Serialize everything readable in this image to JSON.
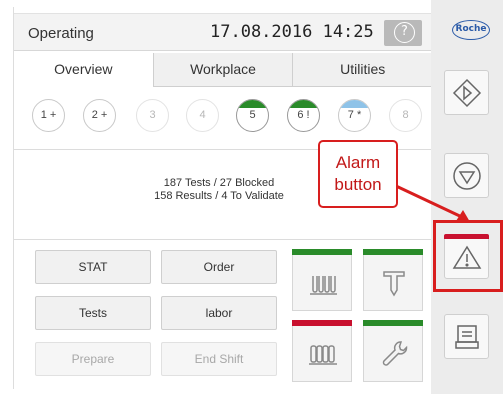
{
  "status": {
    "text": "Operating",
    "datetime": "17.08.2016 14:25",
    "help_icon": "?"
  },
  "tabs": [
    {
      "label": "Overview",
      "active": true
    },
    {
      "label": "Workplace",
      "active": false
    },
    {
      "label": "Utilities",
      "active": false
    }
  ],
  "racks": [
    {
      "label": "1 +",
      "state": "normal",
      "cap": ""
    },
    {
      "label": "2 +",
      "state": "normal",
      "cap": ""
    },
    {
      "label": "3",
      "state": "dim",
      "cap": ""
    },
    {
      "label": "4",
      "state": "dim",
      "cap": ""
    },
    {
      "label": "5",
      "state": "bold",
      "cap": "#2a8b2a"
    },
    {
      "label": "6 !",
      "state": "bold",
      "cap": "#2a8b2a"
    },
    {
      "label": "7 *",
      "state": "normal",
      "cap": "#8fc3e8"
    },
    {
      "label": "8",
      "state": "dim",
      "cap": ""
    }
  ],
  "counters": {
    "line1": "187 Tests / 27 Blocked",
    "line2": "158 Results / 4 To Validate"
  },
  "buttons": {
    "stat": "STAT",
    "order": "Order",
    "tests": "Tests",
    "labor": "labor",
    "prepare": "Prepare",
    "end_shift": "End Shift"
  },
  "tiles": [
    {
      "icon": "sample-tubes-icon",
      "bar": "#2a8b2a"
    },
    {
      "icon": "pipette-icon",
      "bar": "#2a8b2a"
    },
    {
      "icon": "reagent-cartridges-icon",
      "bar": "#c8102e"
    },
    {
      "icon": "wrench-icon",
      "bar": "#2a8b2a"
    }
  ],
  "sidebar": {
    "logo": "Roche",
    "buttons": [
      {
        "icon": "start-icon"
      },
      {
        "icon": "stop-icon"
      },
      {
        "icon": "alarm-icon",
        "alert_color": "#c8102e"
      },
      {
        "icon": "print-icon"
      }
    ]
  },
  "annotation": {
    "text_line1": "Alarm",
    "text_line2": "button",
    "color": "#d81e1e"
  }
}
